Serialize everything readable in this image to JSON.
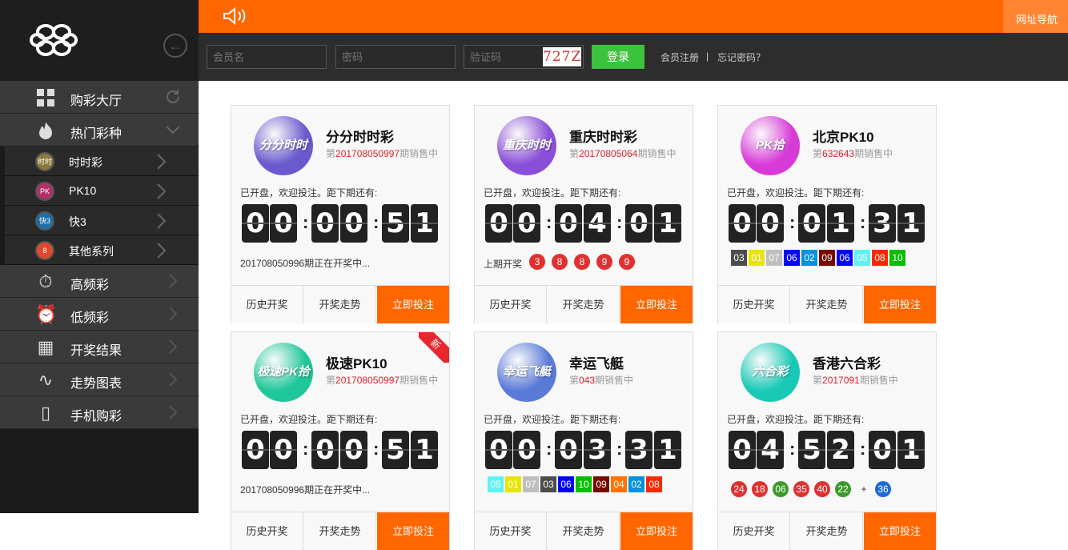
{
  "topbar": {
    "nav_label": "网址导航"
  },
  "login": {
    "username_placeholder": "会员名",
    "password_placeholder": "密码",
    "captcha_placeholder": "验证码",
    "captcha_text": "727Z",
    "login_label": "登录",
    "register_label": "会员注册",
    "separator": "|",
    "forgot_label": "忘记密码？"
  },
  "sidebar": {
    "lobby": "购彩大厅",
    "hot": "热门彩种",
    "sub": [
      {
        "label": "时时彩",
        "badge": "时时",
        "color": "#8a7a3a"
      },
      {
        "label": "PK10",
        "badge": "PK",
        "color": "#b0306a"
      },
      {
        "label": "快3",
        "badge": "快3",
        "color": "#1c6fa8"
      },
      {
        "label": "其他系列",
        "badge": "8",
        "color": "#e0482d"
      }
    ],
    "items": [
      "高频彩",
      "低频彩",
      "开奖结果",
      "走势图表",
      "手机购彩"
    ]
  },
  "cards": [
    {
      "name": "分分时时彩",
      "pre": "第",
      "period": "201708050997",
      "post": "期销售中",
      "status": "已开盘，欢迎投注。距下期还有:",
      "digits": [
        "0",
        "0",
        "0",
        "0",
        "5",
        "1"
      ],
      "info": "201708050996期正在开奖中...",
      "logo_text": "分分时时彩",
      "logo_bg": "#6a5acd"
    },
    {
      "name": "重庆时时彩",
      "pre": "第",
      "period": "20170805064",
      "post": "期销售中",
      "status": "已开盘，欢迎投注。距下期还有:",
      "digits": [
        "0",
        "0",
        "0",
        "4",
        "0",
        "1"
      ],
      "last_label": "上期开奖",
      "balls": [
        "3",
        "8",
        "8",
        "9",
        "9"
      ],
      "logo_text": "重庆时时彩",
      "logo_bg": "#8a4fd8"
    },
    {
      "name": "北京PK10",
      "pre": "第",
      "period": "632643",
      "post": "期销售中",
      "status": "已开盘，欢迎投注。距下期还有:",
      "digits": [
        "0",
        "0",
        "0",
        "1",
        "3",
        "1"
      ],
      "squares": [
        "03",
        "01",
        "07",
        "06",
        "02",
        "09",
        "06",
        "05",
        "08",
        "10"
      ],
      "logo_text": "PK拾",
      "logo_bg": "#d83ad8"
    },
    {
      "name": "极速PK10",
      "pre": "第",
      "period": "201708050997",
      "post": "期销售中",
      "status": "已开盘，欢迎投注。距下期还有:",
      "digits": [
        "0",
        "0",
        "0",
        "0",
        "5",
        "1"
      ],
      "info": "201708050996期正在开奖中...",
      "ribbon": "新",
      "logo_text": "极速PK拾",
      "logo_bg": "#1fc79a"
    },
    {
      "name": "幸运飞艇",
      "pre": "第",
      "period": "043",
      "post": "期销售中",
      "status": "已开盘，欢迎投注。距下期还有:",
      "digits": [
        "0",
        "0",
        "0",
        "3",
        "3",
        "1"
      ],
      "squares": [
        "05",
        "01",
        "07",
        "03",
        "06",
        "10",
        "09",
        "04",
        "02",
        "08"
      ],
      "logo_text": "幸运飞艇",
      "logo_bg": "#5a7ad8"
    },
    {
      "name": "香港六合彩",
      "pre": "第",
      "period": "2017091",
      "post": "期销售中",
      "status": "已开盘，欢迎投注。距下期还有:",
      "digits": [
        "0",
        "4",
        "5",
        "2",
        "0",
        "1"
      ],
      "six": [
        "24",
        "18",
        "06",
        "35",
        "40",
        "22"
      ],
      "plus": "+",
      "special": "36",
      "logo_text": "六合彩",
      "logo_bg": "#18c9b5"
    }
  ],
  "buttons": {
    "history": "历史开奖",
    "trend": "开奖走势",
    "bet": "立即投注"
  },
  "colors": {
    "accent": "#ff6600",
    "pk10": {
      "01": "#e6e600",
      "02": "#0092dd",
      "03": "#4d4d4d",
      "04": "#ff7300",
      "05": "#5ef2f2",
      "06": "#0000ff",
      "07": "#bfbfbf",
      "08": "#ff2600",
      "09": "#780b00",
      "10": "#07bf00"
    },
    "six": {
      "24": "#e03131",
      "18": "#e03131",
      "06": "#3a9a2a",
      "35": "#e03131",
      "40": "#e03131",
      "22": "#3a9a2a",
      "36": "#1a6ad8"
    }
  }
}
